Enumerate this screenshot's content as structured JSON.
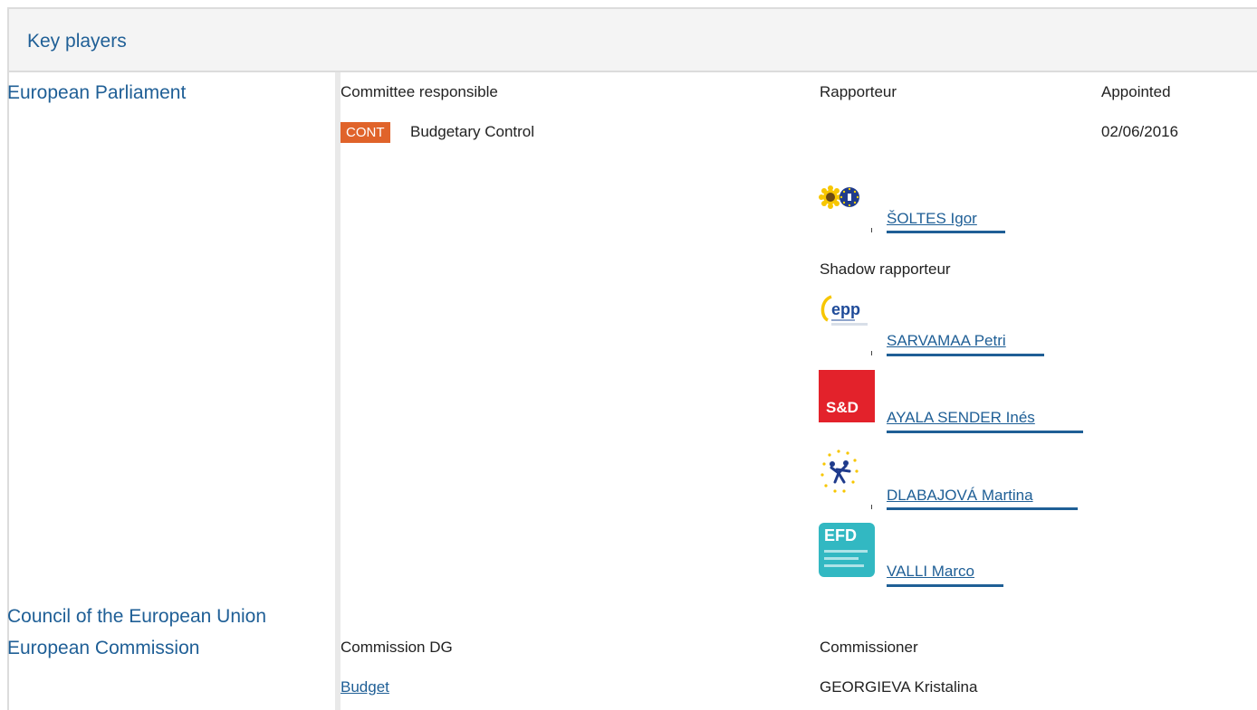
{
  "header": {
    "title": "Key players"
  },
  "ep": {
    "label": "European Parliament",
    "col_committee": "Committee responsible",
    "col_rapporteur": "Rapporteur",
    "col_appointed": "Appointed",
    "committee_code": "CONT",
    "committee_name": "Budgetary Control",
    "appointed_date": "02/06/2016",
    "rapporteur": {
      "name": "ŠOLTES Igor",
      "group_logo": "greens-efa-logo"
    },
    "shadow_label": "Shadow rapporteur",
    "shadows": [
      {
        "name": "SARVAMAA Petri",
        "group_logo": "epp-logo"
      },
      {
        "name": "AYALA SENDER Inés",
        "group_logo": "s-and-d-logo",
        "logo_text": "S&D"
      },
      {
        "name": "DLABAJOVÁ Martina",
        "group_logo": "alde-logo"
      },
      {
        "name": "VALLI Marco",
        "group_logo": "efdd-logo",
        "logo_text": "EFD"
      }
    ]
  },
  "council": {
    "label": "Council of the European Union"
  },
  "commission": {
    "label": "European Commission",
    "col_dg": "Commission DG",
    "col_commissioner": "Commissioner",
    "dg": "Budget",
    "commissioner": "GEORGIEVA Kristalina"
  },
  "colors": {
    "link": "#1f5f96",
    "badge": "#e0632a",
    "s_and_d": "#e3222b",
    "efdd": "#32b8c2"
  }
}
